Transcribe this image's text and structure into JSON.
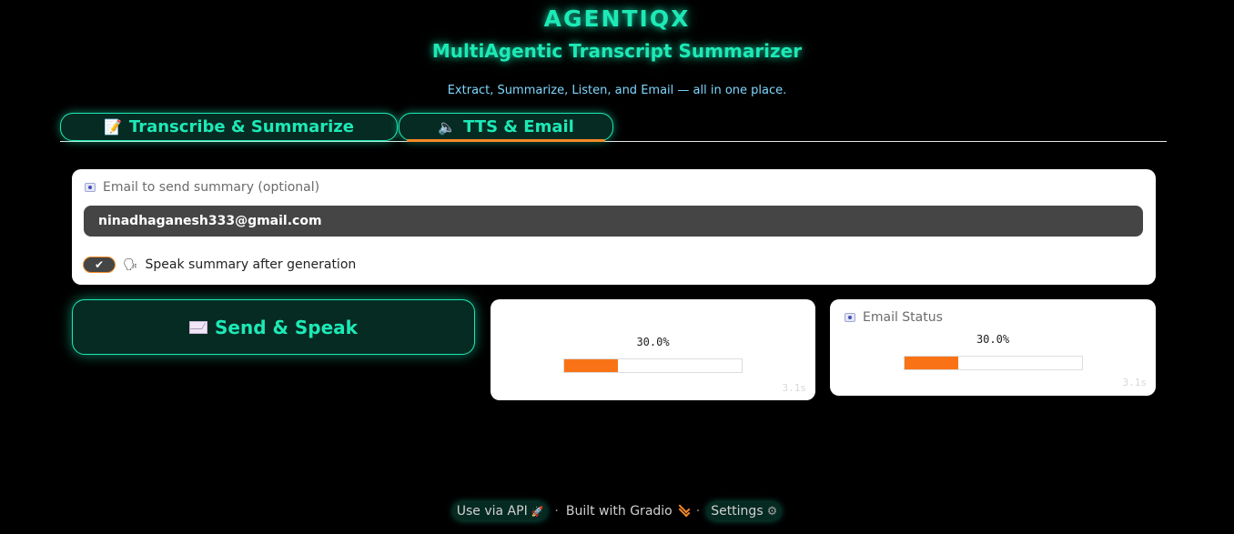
{
  "header": {
    "title": "AGENTIQX",
    "subtitle": "MultiAgentic Transcript Summarizer",
    "tagline": "Extract, Summarize, Listen, and Email — all in one place."
  },
  "tabs": [
    {
      "label": "Transcribe & Summarize",
      "icon": "memo-icon",
      "selected": false
    },
    {
      "label": "TTS & Email",
      "icon": "speaker-icon",
      "selected": true
    }
  ],
  "email_form": {
    "label": "Email to send summary (optional)",
    "value": "ninadhaganesh333@gmail.com",
    "checkbox_label": "Speak summary after generation",
    "checkbox_checked": true
  },
  "send_button": {
    "label": "Send & Speak",
    "icon": "envelope-icon"
  },
  "speak_status": {
    "progress_text": "30.0%",
    "progress": 0.3,
    "elapsed": "3.1s"
  },
  "email_status": {
    "label": "Email Status",
    "progress_text": "30.0%",
    "progress": 0.3,
    "elapsed": "3.1s"
  },
  "footer": {
    "api_label": "Use via API",
    "built_label": "Built with Gradio",
    "settings_label": "Settings",
    "separator": "·"
  },
  "colors": {
    "accent": "#1de9b6",
    "progress": "#f97316",
    "tab_indicator": "#f58a28"
  }
}
